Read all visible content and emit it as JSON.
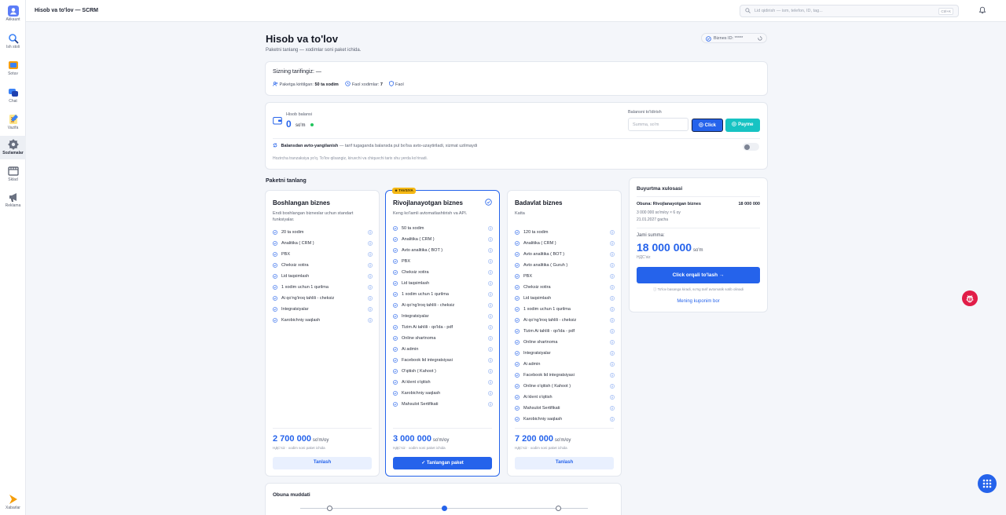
{
  "sidebar": {
    "items": [
      {
        "label": "Akkaunt",
        "icon": "account-icon",
        "color": "#5b7cf7"
      },
      {
        "label": "Ish stoli",
        "icon": "desktop-icon",
        "color": "#3b82f6"
      },
      {
        "label": "Sotuv",
        "icon": "sales-icon",
        "color": "#f59e0b"
      },
      {
        "label": "Chat",
        "icon": "chat-icon",
        "color": "#3b82f6"
      },
      {
        "label": "Vazifa",
        "icon": "task-icon",
        "color": "#f59e0b"
      },
      {
        "label": "Sozlamalar",
        "icon": "settings-icon",
        "color": "#6b7282"
      },
      {
        "label": "Sklad",
        "icon": "warehouse-icon",
        "color": "#4a5162"
      },
      {
        "label": "Reklama",
        "icon": "megaphone-icon",
        "color": "#6b7282"
      }
    ],
    "bottom": {
      "label": "Xabarlar",
      "icon": "messages-icon",
      "color": "#f59e0b"
    }
  },
  "topbar": {
    "title": "Hisob va to'lov — SCRM",
    "search_placeholder": "Lid qidirish — ism, telefon, ID, tag...",
    "shortcut": "Ctrl+K"
  },
  "page": {
    "title": "Hisob va to'lov",
    "subtitle": "Paketni tanlang — xodimlar soni paket ichida.",
    "business_id_label": "Biznes ID:",
    "business_id_value": "*****"
  },
  "tariff": {
    "title": "Sizning tarifingiz: —",
    "employees_label": "Paketga kiritilgan:",
    "employees_value": "50 ta xodim",
    "active_label": "Faol xodimlar:",
    "active_value": "7",
    "status": "Faol"
  },
  "balance": {
    "label": "Hisob balansi",
    "value": "0",
    "unit": "so'm",
    "topup_label": "Balansni to'ldirish",
    "topup_placeholder": "Summa, so'm",
    "click_label": "Click",
    "payme_label": "Payme",
    "auto_title": "Balansdan avto-yangilanish",
    "auto_desc": "— tarif tugaganda balansda pul bo'lsa avto-uzaytiriladi, xizmat uzilmaydi",
    "no_transactions": "Hozircha tranzaksiya yo'q. To'lov qilsangiz, kiruvchi va chiquvchi tarix shu yerda ko'rinadi.",
    "auto_enabled": false
  },
  "plans_section": {
    "title": "Paketni tanlang"
  },
  "plans": [
    {
      "name": "Boshlangan biznes",
      "desc": "Endi boshlangan bizneslar uchun standart funksiyalar.",
      "features": [
        "20 ta xodim",
        "Analitika ( CRM )",
        "PBX",
        "Cheksiz xotira",
        "Lid taqsimlash",
        "1 xodim uchun 1 qurilma",
        "Ai qo'ng'iroq tahlili - cheksiz",
        "Integratsiyalar",
        "Karobichniy saqlash"
      ],
      "price": "2 700 000",
      "per": "so'm/oy",
      "note": "НДС'siz · xodim soni paket ichida",
      "button": "Tanlash",
      "selected": false
    },
    {
      "name": "Rivojlanayotgan biznes",
      "badge": "★ TAVSIYA",
      "desc": "Keng ko'lamli avtomatlashtirish va API.",
      "features": [
        "50 ta xodim",
        "Analitika ( CRM )",
        "Avto analitika ( BOT )",
        "PBX",
        "Cheksiz xotira",
        "Lid taqsimlash",
        "1 xodim uchun 1 qurilma",
        "Ai qo'ng'iroq tahlili - cheksiz",
        "Integratsiyalar",
        "Tizim Ai tahlili - qo'lda - pdf",
        "Online shartnoma",
        "Ai admin",
        "Facebook lid integratsiyasi",
        "O'qitish ( Kahoot )",
        "Ai klent o'qitish",
        "Karobichniy saqlash",
        "Mahsulot Sertifikati"
      ],
      "price": "3 000 000",
      "per": "so'm/oy",
      "note": "НДС'siz · xodim soni paket ichida",
      "button": "✓ Tanlangan paket",
      "selected": true
    },
    {
      "name": "Badavlat biznes",
      "desc": "Katta",
      "features": [
        "120 ta xodim",
        "Analitika ( CRM )",
        "Avto analitika ( BOT )",
        "Avto analitika ( Guruh )",
        "PBX",
        "Cheksiz xotira",
        "Lid taqsimlash",
        "1 xodim uchun 1 qurilma",
        "Ai qo'ng'iroq tahlili - cheksiz",
        "Tizim Ai tahlili - qo'lda - pdf",
        "Online shartnoma",
        "Integratsiyalar",
        "Ai admin",
        "Facebook lid integratsiyasi",
        "Online o'qitish ( Kahoot )",
        "Ai klent o'qitish",
        "Mahsulot Sertifikati",
        "Karobichniy saqlash"
      ],
      "price": "7 200 000",
      "per": "so'm/oy",
      "note": "НДС'siz · xodim soni paket ichida",
      "button": "Tanlash",
      "selected": false
    }
  ],
  "summary": {
    "title": "Buyurtma xulosasi",
    "sub_title": "Obuna: Rivojlanayotgan biznes",
    "sub_amount": "18 000 000",
    "line1": "3 000 000 so'm/oy × 6 oy",
    "line2": "21.01.2027 gacha",
    "total_label": "Jami summa:",
    "total": "18 000 000",
    "total_unit": "so'm",
    "vat": "НДС'siz",
    "pay_button": "Click orqali to'lash →",
    "note": "ⓘ To'lov basanga kiradi, so'ng tarif avtomatik sotib olinadi",
    "coupon": "Mening kuponim bor"
  },
  "duration": {
    "title": "Obuna muddati",
    "selected_index": 1
  },
  "colors": {
    "accent": "#2563eb",
    "payme": "#17c3c3",
    "badge": "#f5b814",
    "danger": "#e11d48"
  }
}
